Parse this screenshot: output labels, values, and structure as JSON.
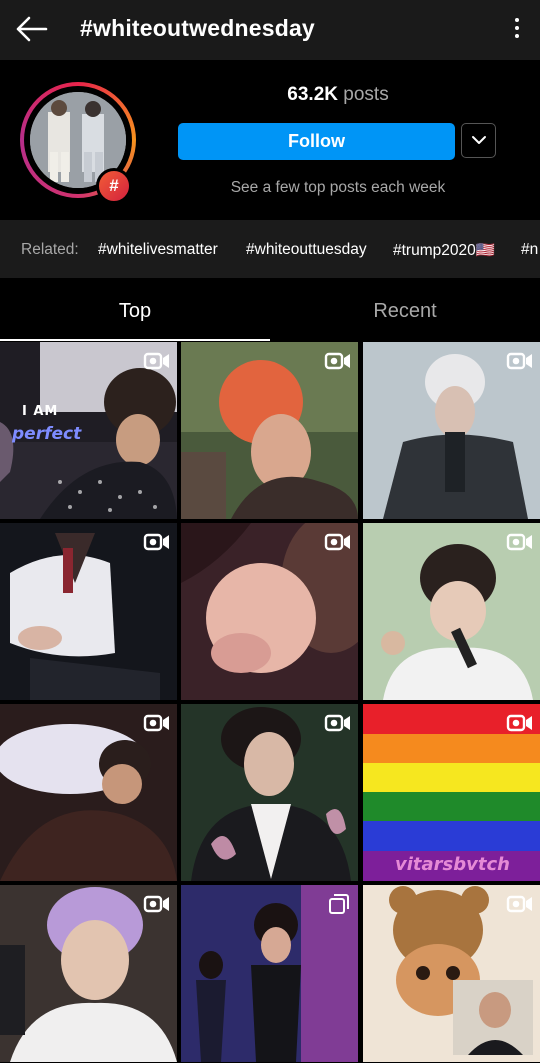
{
  "header_bar": {
    "title": "#whiteoutwednesday",
    "back_icon": "arrow-left-icon",
    "menu_icon": "kebab-menu-icon"
  },
  "profile": {
    "posts_count": "63.2K",
    "posts_label": "posts",
    "follow_label": "Follow",
    "subtitle": "See a few top posts each week",
    "badge_symbol": "#",
    "colors": {
      "follow": "#0095f6",
      "badge": "#e8344a"
    }
  },
  "related": {
    "label": "Related:",
    "tags": [
      "#whitelivesmatter",
      "#whiteouttuesday",
      "#trump2020🇺🇸",
      "#n"
    ]
  },
  "tabs": {
    "top": "Top",
    "recent": "Recent"
  },
  "grid": {
    "overlay_texts": {
      "i_am": "I AM",
      "perfect": "perfect",
      "vitarsbvtch": "vitarsbvtch"
    },
    "posts": [
      {
        "type": "reel-icon"
      },
      {
        "type": "reel-icon"
      },
      {
        "type": "reel-icon"
      },
      {
        "type": "reel-icon"
      },
      {
        "type": "reel-icon"
      },
      {
        "type": "reel-icon"
      },
      {
        "type": "reel-icon"
      },
      {
        "type": "reel-icon"
      },
      {
        "type": "reel-icon"
      },
      {
        "type": "reel-icon"
      },
      {
        "type": "carousel-icon"
      },
      {
        "type": "reel-icon"
      }
    ]
  }
}
